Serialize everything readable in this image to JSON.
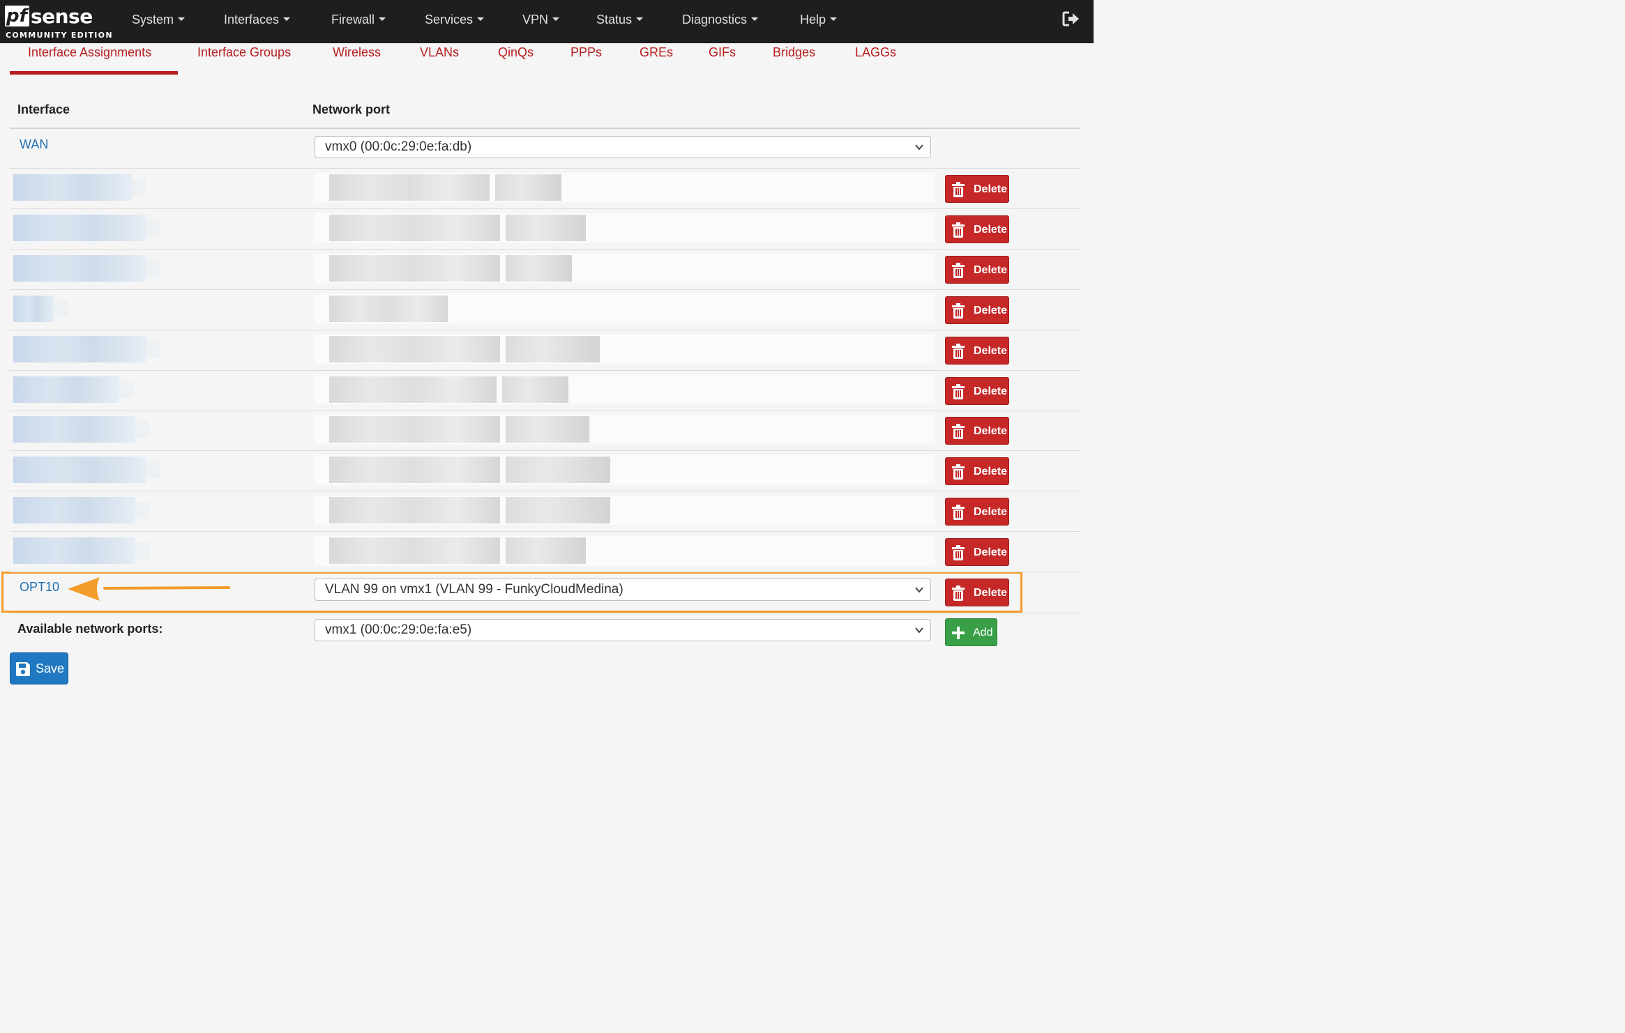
{
  "brand": {
    "logo_pf": "pf",
    "logo_sense": "sense",
    "edition": "COMMUNITY EDITION"
  },
  "nav": {
    "items": [
      {
        "label": "System"
      },
      {
        "label": "Interfaces"
      },
      {
        "label": "Firewall"
      },
      {
        "label": "Services"
      },
      {
        "label": "VPN"
      },
      {
        "label": "Status"
      },
      {
        "label": "Diagnostics"
      },
      {
        "label": "Help"
      }
    ],
    "logout_icon": "logout-icon"
  },
  "tabs": {
    "active": "Interface Assignments",
    "items": [
      {
        "label": "Interface Assignments"
      },
      {
        "label": "Interface Groups"
      },
      {
        "label": "Wireless"
      },
      {
        "label": "VLANs"
      },
      {
        "label": "QinQs"
      },
      {
        "label": "PPPs"
      },
      {
        "label": "GREs"
      },
      {
        "label": "GIFs"
      },
      {
        "label": "Bridges"
      },
      {
        "label": "LAGGs"
      }
    ]
  },
  "table": {
    "headers": {
      "interface": "Interface",
      "network_port": "Network port"
    },
    "wan": {
      "name": "WAN",
      "port": "vmx0 (00:0c:29:0e:fa:db)"
    },
    "obscured_rows_count": 10,
    "delete_label": "Delete",
    "opt10": {
      "name": "OPT10",
      "port": "VLAN 99 on vmx1 (VLAN 99 - FunkyCloudMedina)"
    },
    "available": {
      "label": "Available network ports:",
      "port": "vmx1 (00:0c:29:0e:fa:e5)",
      "add_label": "Add"
    }
  },
  "save_label": "Save",
  "colors": {
    "accent": "#b71c1c",
    "link": "#1f6fb2",
    "highlight": "#f39c2b",
    "danger": "#c62828",
    "success": "#3aa047",
    "primary": "#1f78c1"
  }
}
